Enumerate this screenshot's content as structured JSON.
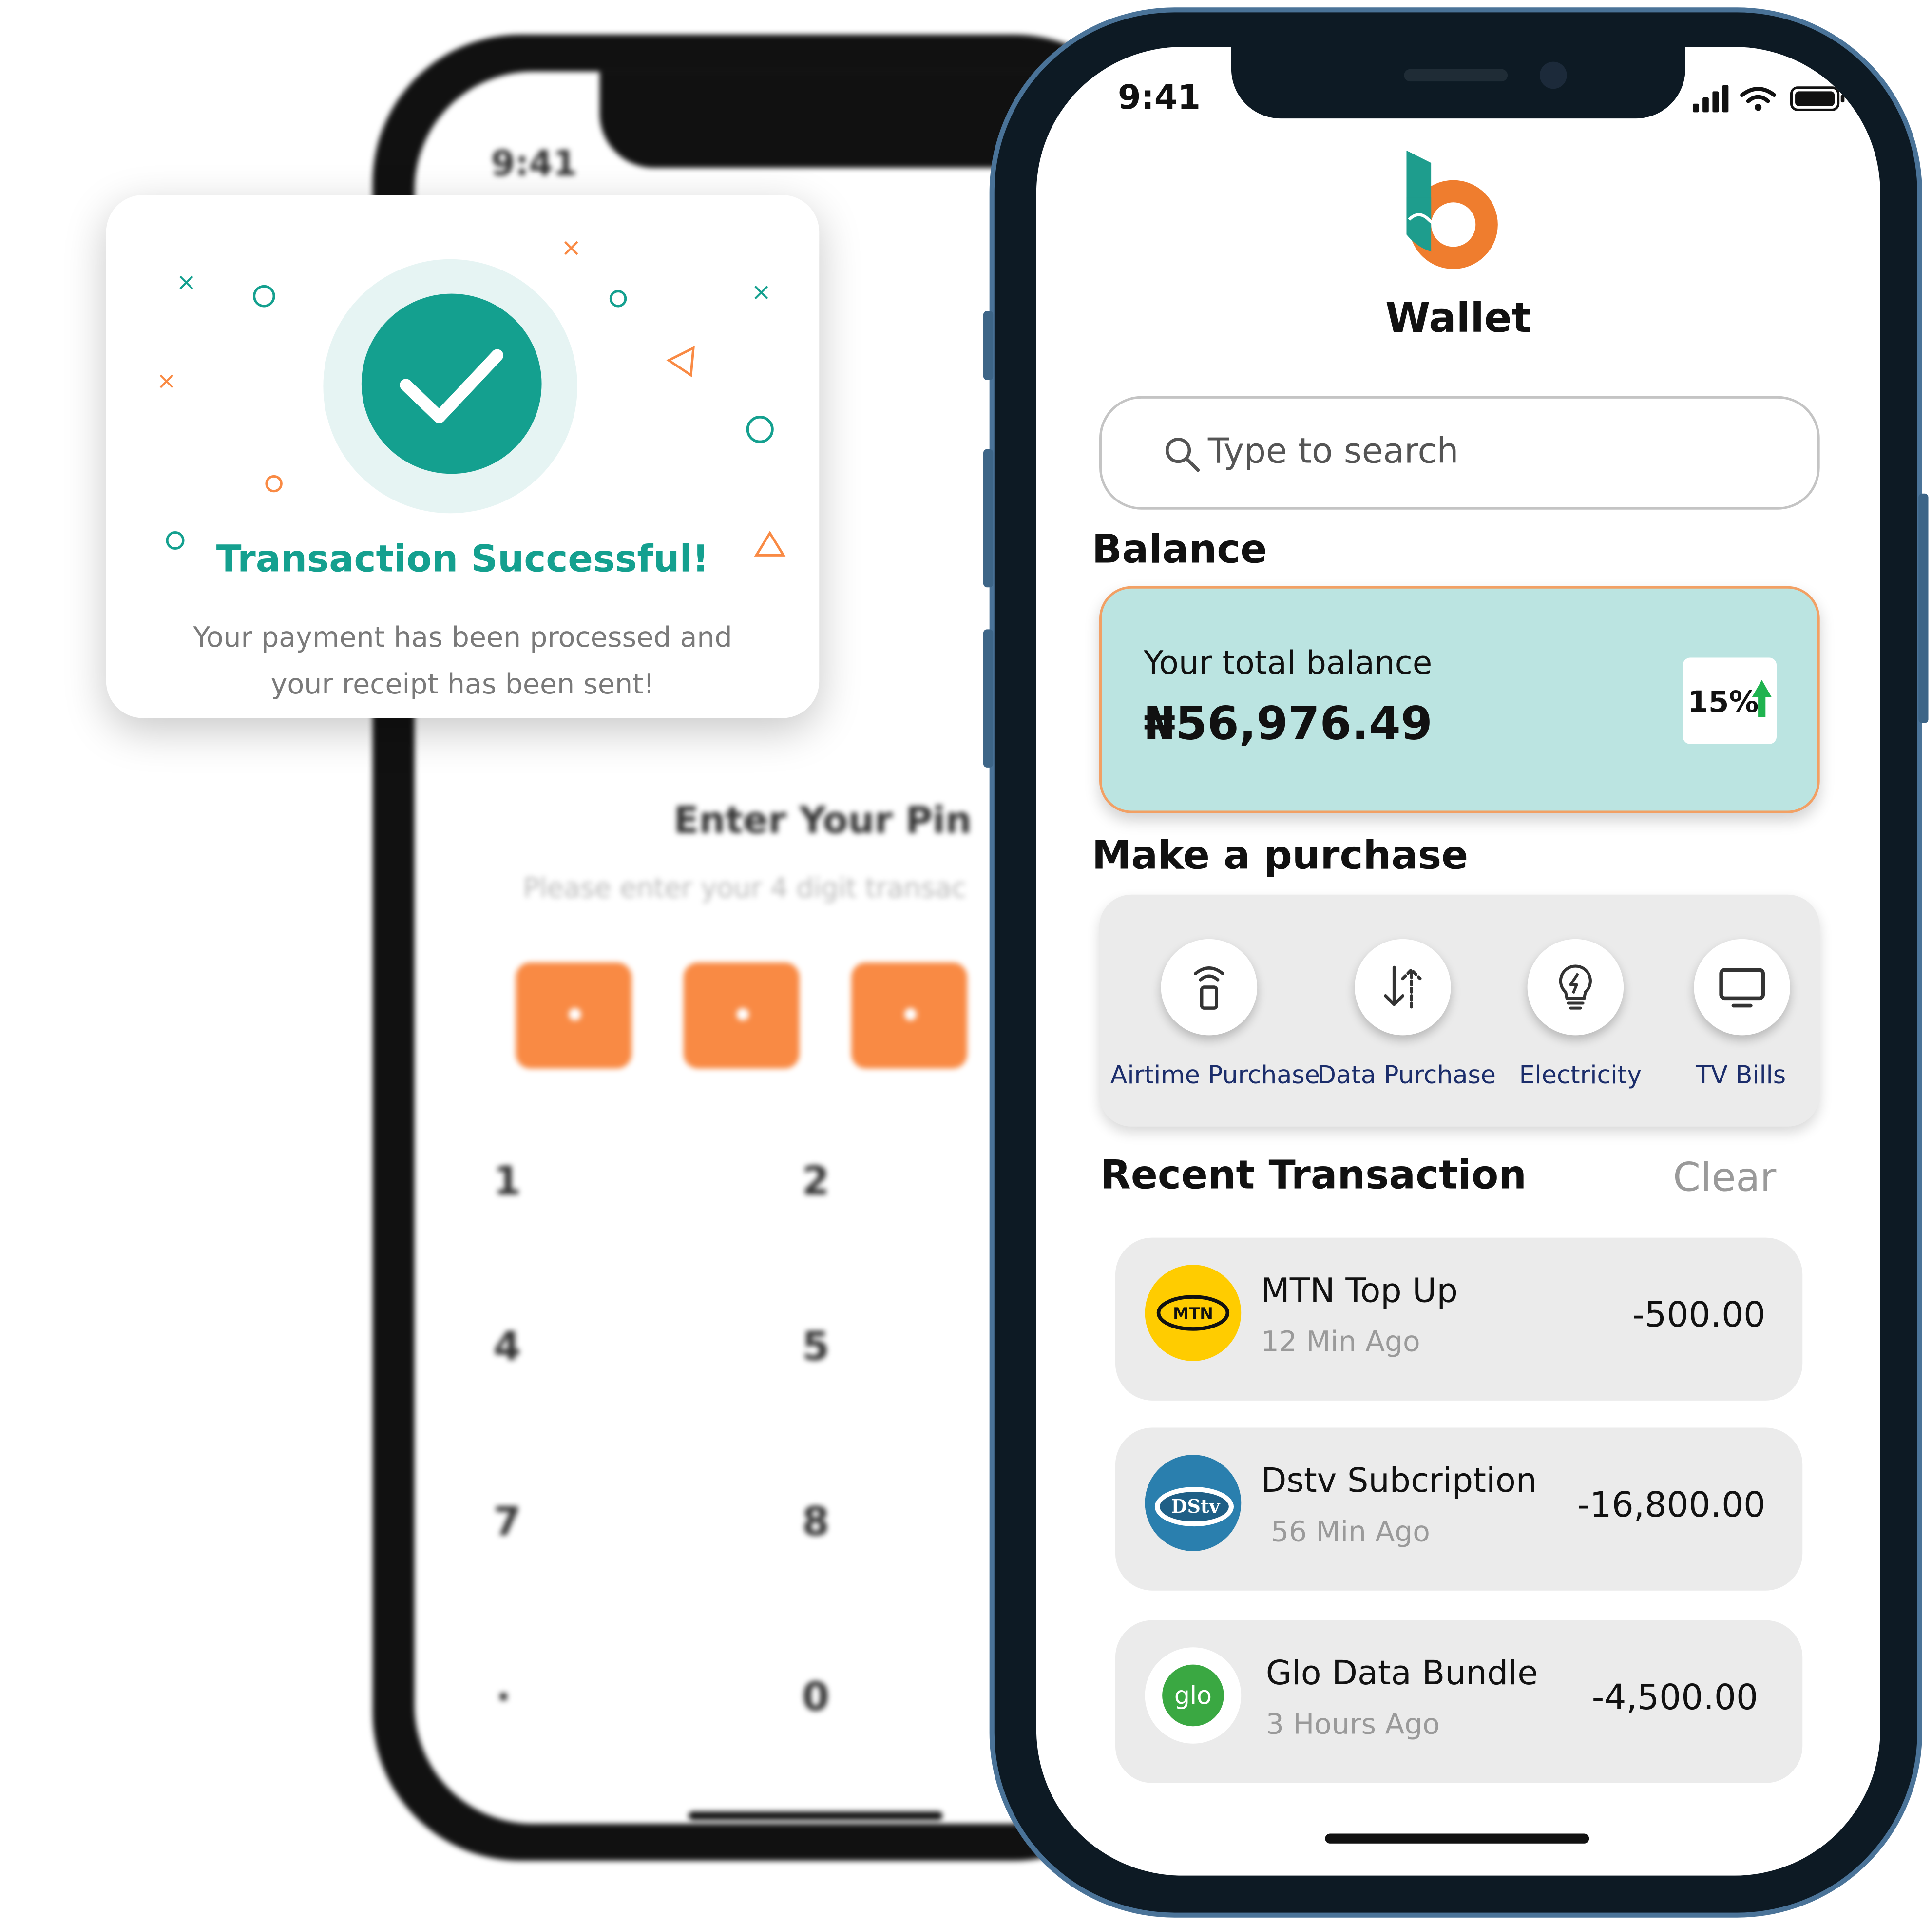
{
  "pin_screen": {
    "time": "9:41",
    "title": "Enter Your Pin",
    "subtitle": "Please enter your 4 digit transac",
    "keypad": [
      "1",
      "2",
      "4",
      "5",
      "7",
      "8",
      ".",
      "0"
    ]
  },
  "success_modal": {
    "title": "Transaction Successful!",
    "message": "Your payment has been processed and your receipt has been sent!"
  },
  "wallet": {
    "time": "9:41",
    "app_title": "Wallet",
    "search_placeholder": "Type to search",
    "balance": {
      "section_label": "Balance",
      "label": "Your total balance",
      "amount": "₦56,976.49",
      "change": "15%"
    },
    "purchase": {
      "section_label": "Make a purchase",
      "items": [
        {
          "label": "Airtime Purchase",
          "icon": "phone-signal-icon"
        },
        {
          "label": "Data Purchase",
          "icon": "data-transfer-icon"
        },
        {
          "label": "Electricity",
          "icon": "lightbulb-icon"
        },
        {
          "label": "TV Bills",
          "icon": "tv-icon"
        }
      ]
    },
    "recent": {
      "section_label": "Recent Transaction",
      "clear_label": "Clear",
      "items": [
        {
          "name": "MTN Top Up",
          "time": "12 Min Ago",
          "amount": "-500.00",
          "logo_text": "MTN"
        },
        {
          "name": "Dstv Subcription",
          "time": "56 Min Ago",
          "amount": "-16,800.00",
          "logo_text": "DStv"
        },
        {
          "name": "Glo Data Bundle",
          "time": "3 Hours Ago",
          "amount": "-4,500.00",
          "logo_text": "glo"
        }
      ]
    }
  },
  "colors": {
    "teal": "#14a08f",
    "orange": "#f98a44",
    "balance_bg": "#bbe4e1",
    "navy_label": "#1b2d6b",
    "frame_blue": "#4a7398"
  }
}
